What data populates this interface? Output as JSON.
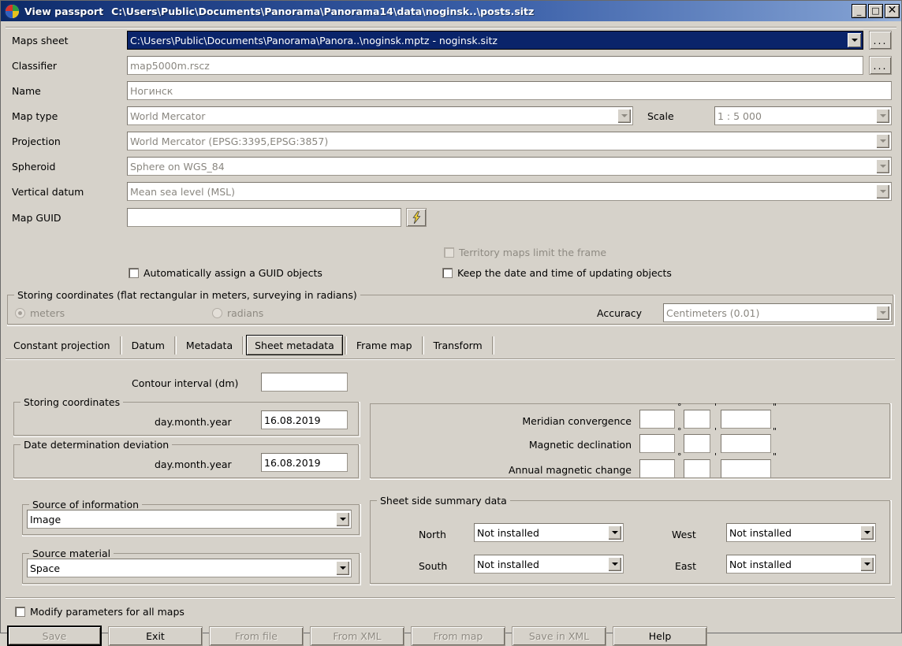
{
  "window": {
    "title": "View passport",
    "path": "C:\\Users\\Public\\Documents\\Panorama\\Panorama14\\data\\noginsk..\\posts.sitz",
    "minimize": "_",
    "maximize": "□",
    "close": "✕",
    "app_icon": "panorama-globe-icon"
  },
  "passport": {
    "maps_sheet": {
      "label": "Maps sheet",
      "value": "C:\\Users\\Public\\Documents\\Panorama\\Panora..\\noginsk.mptz - noginsk.sitz",
      "browse": "..."
    },
    "classifier": {
      "label": "Classifier",
      "value": "map5000m.rscz",
      "browse": "..."
    },
    "name": {
      "label": "Name",
      "value": "Ногинск"
    },
    "map_type": {
      "label": "Map type",
      "value": "World Mercator"
    },
    "scale": {
      "label": "Scale",
      "value": "1 : 5 000"
    },
    "projection": {
      "label": "Projection",
      "value": "World Mercator (EPSG:3395,EPSG:3857)"
    },
    "spheroid": {
      "label": "Spheroid",
      "value": "Sphere on WGS_84"
    },
    "vertical_datum": {
      "label": "Vertical datum",
      "value": "Mean sea level (MSL)"
    },
    "map_guid": {
      "label": "Map GUID",
      "value": "",
      "generate_icon": "lightning-bolt-icon"
    },
    "auto_guid": {
      "label": "Automatically assign a GUID objects",
      "checked": false
    },
    "territory_limit": {
      "label": "Territory maps limit the frame",
      "checked": false
    },
    "keep_datetime": {
      "label": "Keep the date and time of updating objects",
      "checked": false
    }
  },
  "storing_coordinates_top": {
    "title": "Storing coordinates (flat rectangular in meters, surveying in radians)",
    "meters": "meters",
    "radians": "radians",
    "selected": "meters",
    "accuracy_label": "Accuracy",
    "accuracy_value": "Centimeters (0.01)"
  },
  "tabs": [
    {
      "label": "Constant projection",
      "active": false
    },
    {
      "label": "Datum",
      "active": false
    },
    {
      "label": "Metadata",
      "active": false
    },
    {
      "label": "Sheet metadata",
      "active": true
    },
    {
      "label": "Frame map",
      "active": false
    },
    {
      "label": "Transform",
      "active": false
    }
  ],
  "sheet_metadata": {
    "contour_interval": {
      "label": "Contour interval (dm)",
      "value": ""
    },
    "storing_coordinates": {
      "title": "Storing coordinates",
      "date_label": "day.month.year",
      "date_value": "16.08.2019"
    },
    "date_deviation": {
      "title": "Date determination deviation",
      "date_label": "day.month.year",
      "date_value": "16.08.2019"
    },
    "source_of_information": {
      "title": "Source of information",
      "value": "Image"
    },
    "source_material": {
      "title": "Source material",
      "value": "Space"
    },
    "angles": {
      "deg_symbol": "°",
      "min_symbol": "'",
      "sec_symbol": "\"",
      "rows": [
        {
          "label": "Meridian convergence",
          "deg": "",
          "min": "",
          "sec": ""
        },
        {
          "label": "Magnetic declination",
          "deg": "",
          "min": "",
          "sec": ""
        },
        {
          "label": "Annual magnetic change",
          "deg": "",
          "min": "",
          "sec": ""
        }
      ]
    },
    "sheet_side": {
      "title": "Sheet side summary data",
      "north": {
        "label": "North",
        "value": "Not installed"
      },
      "south": {
        "label": "South",
        "value": "Not installed"
      },
      "west": {
        "label": "West",
        "value": "Not installed"
      },
      "east": {
        "label": "East",
        "value": "Not installed"
      }
    }
  },
  "footer": {
    "modify_all": {
      "label": "Modify parameters for all maps",
      "checked": false
    },
    "buttons": [
      {
        "label": "Save",
        "disabled": true,
        "default": true
      },
      {
        "label": "Exit",
        "disabled": false,
        "default": false
      },
      {
        "label": "From file",
        "disabled": true,
        "default": false
      },
      {
        "label": "From XML",
        "disabled": true,
        "default": false
      },
      {
        "label": "From map",
        "disabled": true,
        "default": false
      },
      {
        "label": "Save in XML",
        "disabled": true,
        "default": false
      },
      {
        "label": "Help",
        "disabled": false,
        "default": false
      }
    ]
  },
  "colors": {
    "window_face": "#d6d2ca",
    "title_active": "#0c2a66",
    "selection": "#0a246a",
    "disabled_text": "#8e8a82"
  }
}
